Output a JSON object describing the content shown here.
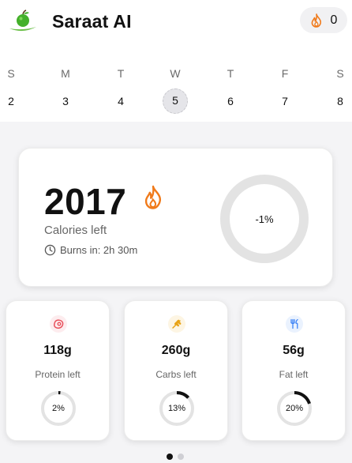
{
  "header": {
    "app_title": "Saraat AI",
    "logo_icon": "apple-icon",
    "streak_icon": "flame-icon",
    "streak_count": "0"
  },
  "week": {
    "days": [
      {
        "letter": "S",
        "num": "2"
      },
      {
        "letter": "M",
        "num": "3"
      },
      {
        "letter": "T",
        "num": "4"
      },
      {
        "letter": "W",
        "num": "5",
        "selected": true
      },
      {
        "letter": "T",
        "num": "6"
      },
      {
        "letter": "F",
        "num": "7"
      },
      {
        "letter": "S",
        "num": "8"
      }
    ]
  },
  "calories": {
    "value": "2017",
    "label": "Calories left",
    "burns_text": "Burns in: 2h 30m",
    "progress_label": "-1%",
    "progress_fraction": 0
  },
  "macros": [
    {
      "name": "protein",
      "icon": "steak-icon",
      "value": "118g",
      "label": "Protein left",
      "percent_label": "2%",
      "fraction": 0.02,
      "accent": "#e8505b",
      "icon_bg": "#fdecee"
    },
    {
      "name": "carbs",
      "icon": "wheat-icon",
      "value": "260g",
      "label": "Carbs left",
      "percent_label": "13%",
      "fraction": 0.13,
      "accent": "#e8a317",
      "icon_bg": "#fdf5e3"
    },
    {
      "name": "fat",
      "icon": "utensils-icon",
      "value": "56g",
      "label": "Fat left",
      "percent_label": "20%",
      "fraction": 0.2,
      "accent": "#3b82f6",
      "icon_bg": "#eaf2fe"
    }
  ],
  "pager": {
    "count": 2,
    "active": 0
  },
  "colors": {
    "flame": "#f07a1a",
    "ring_track": "#e3e3e3",
    "ring_fill": "#111111"
  }
}
